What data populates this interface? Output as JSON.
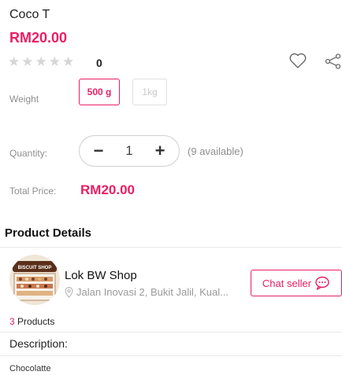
{
  "product": {
    "title": "Coco T",
    "price": "RM20.00",
    "rating": 0,
    "rating_count": "0",
    "stars": [
      "★",
      "★",
      "★",
      "★",
      "★"
    ]
  },
  "weight": {
    "label": "Weight",
    "options": [
      {
        "label": "500 g",
        "selected": true
      },
      {
        "label": "1kg",
        "selected": false
      }
    ]
  },
  "quantity": {
    "label": "Quantity:",
    "decrement": "−",
    "value": "1",
    "increment": "+",
    "available": "(9 available)"
  },
  "total": {
    "label": "Total Price:",
    "value": "RM20.00"
  },
  "details": {
    "heading": "Product Details"
  },
  "shop": {
    "name": "Lok BW Shop",
    "location": "Jalan Inovasi 2, Bukit Jalil, Kual...",
    "chat_label": "Chat seller",
    "product_count": "3",
    "product_label": " Products",
    "logo_text": "BISCUIT SHOP"
  },
  "description": {
    "heading": "Description:",
    "text": "Chocolatte"
  },
  "colors": {
    "accent": "#e91e63",
    "muted": "#8e8e8e",
    "star_empty": "#d6d6d6"
  },
  "icons": [
    "heart-icon",
    "share-icon",
    "location-pin-icon",
    "chat-bubble-icon"
  ]
}
